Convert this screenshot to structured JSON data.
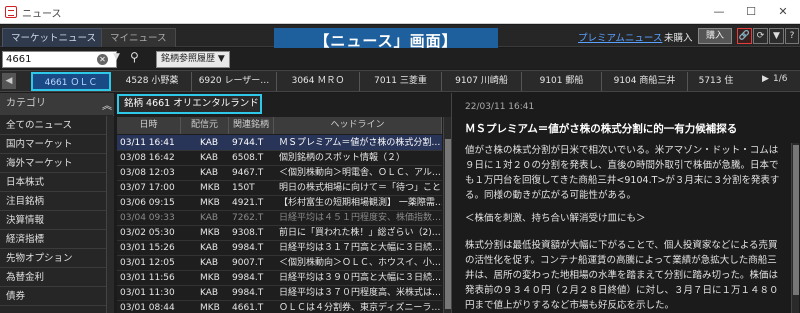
{
  "window": {
    "title": "ニュース",
    "minimize": "—",
    "maximize": "☐",
    "close": "✕"
  },
  "tabs": [
    {
      "label": "マーケットニュース"
    },
    {
      "label": "マイニュース"
    }
  ],
  "banner": "【ニュース」画面】",
  "premium_link": "プレミアムニュース",
  "unbought": "未購入",
  "buy_button": "購入",
  "toolbar_icons": [
    "link-icon",
    "refresh-icon",
    "filter-icon",
    "help-icon"
  ],
  "search": {
    "value": "4661",
    "clear": "✕",
    "caret": "▼",
    "icon": "⚲",
    "history_label": "銘柄参照履歴 ▼"
  },
  "stock_tabs": [
    "4661 ＯＬＣ",
    "4528 小野薬",
    "6920 レーザー…",
    "3064 ＭＲＯ",
    "7011 三菱重",
    "9107 川崎船",
    "9101 郵船",
    "9104 商船三井",
    "5713 住"
  ],
  "pager": {
    "left": "◀",
    "right": "▶",
    "page": "1/6"
  },
  "category": {
    "header": "カテゴリ",
    "collapse": "︽",
    "items": [
      "全てのニュース",
      "国内マーケット",
      "海外マーケット",
      "日本株式",
      "注目銘柄",
      "決算情報",
      "経済指標",
      "先物オプション",
      "為替金利",
      "債券"
    ]
  },
  "stock_label": "銘柄 4661 オリエンタルランド",
  "columns": [
    "日時",
    "配信元",
    "関連銘柄",
    "ヘッドライン"
  ],
  "rows": [
    {
      "date": "03/11 16:41",
      "src": "KAB",
      "code": "9744.T",
      "headline": "ＭＳプレミアム＝値がさ株の株式分割…",
      "style": "sel"
    },
    {
      "date": "03/08 16:42",
      "src": "KAB",
      "code": "6508.T",
      "headline": "個別銘柄のスポット情報（２）",
      "style": ""
    },
    {
      "date": "03/08 12:03",
      "src": "KAB",
      "code": "9467.T",
      "headline": "＜個別株動向＞明電舎、ＯＬＣ、アル…",
      "style": ""
    },
    {
      "date": "03/07 17:00",
      "src": "MKB",
      "code": "150T",
      "headline": "明日の株式相場に向けて＝「待つ」こと…",
      "style": ""
    },
    {
      "date": "03/06 09:15",
      "src": "MKB",
      "code": "4921.T",
      "headline": "【杉村富生の短期相場観測】 一薬際需…",
      "style": ""
    },
    {
      "date": "03/04 09:33",
      "src": "KAB",
      "code": "7262.T",
      "headline": "日経平均は４５１円程度安、株価指数…",
      "style": "gray"
    },
    {
      "date": "03/02 05:30",
      "src": "MKB",
      "code": "9308.T",
      "headline": "前日に「買われた株！」総ざらい（2)…",
      "style": ""
    },
    {
      "date": "03/01 15:26",
      "src": "KAB",
      "code": "9984.T",
      "headline": "日経平均は３１７円高と大幅に３日続…",
      "style": ""
    },
    {
      "date": "03/01 12:05",
      "src": "KAB",
      "code": "9007.T",
      "headline": "＜個別株動向＞ＯＬＣ、ホウスイ、小…",
      "style": ""
    },
    {
      "date": "03/01 11:56",
      "src": "MKB",
      "code": "9984.T",
      "headline": "日経平均は３９０円高と大幅に３日続…",
      "style": ""
    },
    {
      "date": "03/01 11:30",
      "src": "KAB",
      "code": "9984.T",
      "headline": "日経平均は３７０円程度高、米株式は…",
      "style": ""
    },
    {
      "date": "03/01 08:44",
      "src": "MKB",
      "code": "4661.T",
      "headline": "ＯＬＣは４分割券、東京ディズニーラ…",
      "style": ""
    }
  ],
  "detail": {
    "time": "22/03/11 16:41",
    "headline": "ＭＳプレミアム＝値がさ株の株式分割に的一有力候補探る",
    "paragraphs": [
      "値がさ株の株式分割が日米で相次いでいる。米アマゾン・ドット・コムは９日に１対２０の分割を発表し、直後の時間外取引で株価が急騰。日本でも１万円台を回復してきた商船三井<9104.T>が３月末に３分割を発表する。同様の動きが広がる可能性がある。",
      "＜株価を刺激、持ち合い解消受け皿にも＞",
      "株式分割は最低投資額が大幅に下がることで、個人投資家などによる売買の活性化を促す。コンテナ船運賃の高騰によって業績が急拡大した商船三井は、居所の変わった地相場の水準を踏まえて分割に踏み切った。株価は発表前の９３４０円（２月２８日終値）に対し、３月７日に１万１４８０円まで値上がりするなど市場も好反応を示した。"
    ]
  }
}
